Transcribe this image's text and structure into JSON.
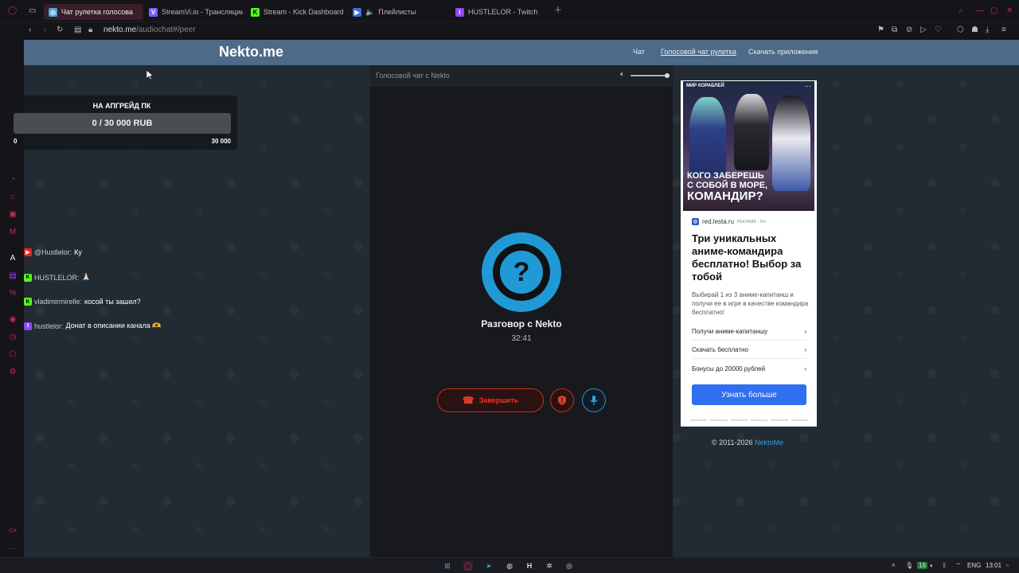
{
  "browser": {
    "tabs": [
      {
        "label": "Чат рулетка голосова",
        "icon": "nekto-favicon",
        "color": "#4aa3d8",
        "active": true
      },
      {
        "label": "StreamVi.io - Трансляции",
        "icon": "streamvi-favicon",
        "color": "#7b5cff",
        "active": false
      },
      {
        "label": "Stream - Kick Dashboard",
        "icon": "kick-favicon",
        "color": "#53fc18",
        "active": false
      },
      {
        "label": "Плейлисты",
        "icon": "youtube-favicon",
        "color": "#3b6fd9",
        "active": false
      },
      {
        "label": "HUSTLELOR - Twitch",
        "icon": "twitch-favicon",
        "color": "#9146ff",
        "active": false
      }
    ],
    "url_host": "nekto.me",
    "url_path": "/audiochat#/peer"
  },
  "site": {
    "logo": "Nekto.me",
    "nav": [
      "Чат",
      "Голосовой чат рулетка",
      "Скачать приложения"
    ]
  },
  "voice_chat": {
    "header": "Голосовой чат с Nekto",
    "avatar_symbol": "?",
    "title": "Разговор с Nekto",
    "timer": "32:41",
    "end_label": "Завершить",
    "volume_level": 0.9
  },
  "ad": {
    "brand": "МИР КОРАБЛЕЙ",
    "image_text_1": "КОГО ЗАБЕРЕШЬ",
    "image_text_2": "С СОБОЙ В МОРЕ,",
    "image_text_3": "КОМАНДИР?",
    "source": "red.lesta.ru",
    "tag": "РЕКЛАМА · 16+",
    "headline": "Три уникальных аниме-командира бесплатно! Выбор за тобой",
    "body": "Выбирай 1 из 3 аниме-капитанш и получи ее в игре в качестве командира бесплатно!",
    "links": [
      "Получи аниме-капитаншу",
      "Скачать бесплатно",
      "Бонусы до 20000 рублей"
    ],
    "cta": "Узнать больше"
  },
  "footer": {
    "copyright": "© 2011-2026 ",
    "link": "NektoMe"
  },
  "donation": {
    "title": "НА АПГРЕЙД ПК",
    "progress_text": "0 / 30 000 RUB",
    "progress": 0,
    "min": "0",
    "max": "30 000"
  },
  "stream_chat": [
    {
      "platform": "youtube",
      "color": "#e62117",
      "user": "@Hustlelor:",
      "text": "Ку"
    },
    {
      "platform": "kick",
      "color": "#53fc18",
      "user": "HUSTLELOR:",
      "text": "🙏🏻"
    },
    {
      "platform": "kick",
      "color": "#53fc18",
      "user": "vladimirmirelle:",
      "text": "косой ты зашел?"
    },
    {
      "platform": "twitch",
      "color": "#9146ff",
      "user": "hustlelor:",
      "text": "Донат в описании канала 🫶"
    }
  ],
  "taskbar": {
    "lang": "ENG",
    "time": "13:01",
    "battery_badge": "16"
  }
}
